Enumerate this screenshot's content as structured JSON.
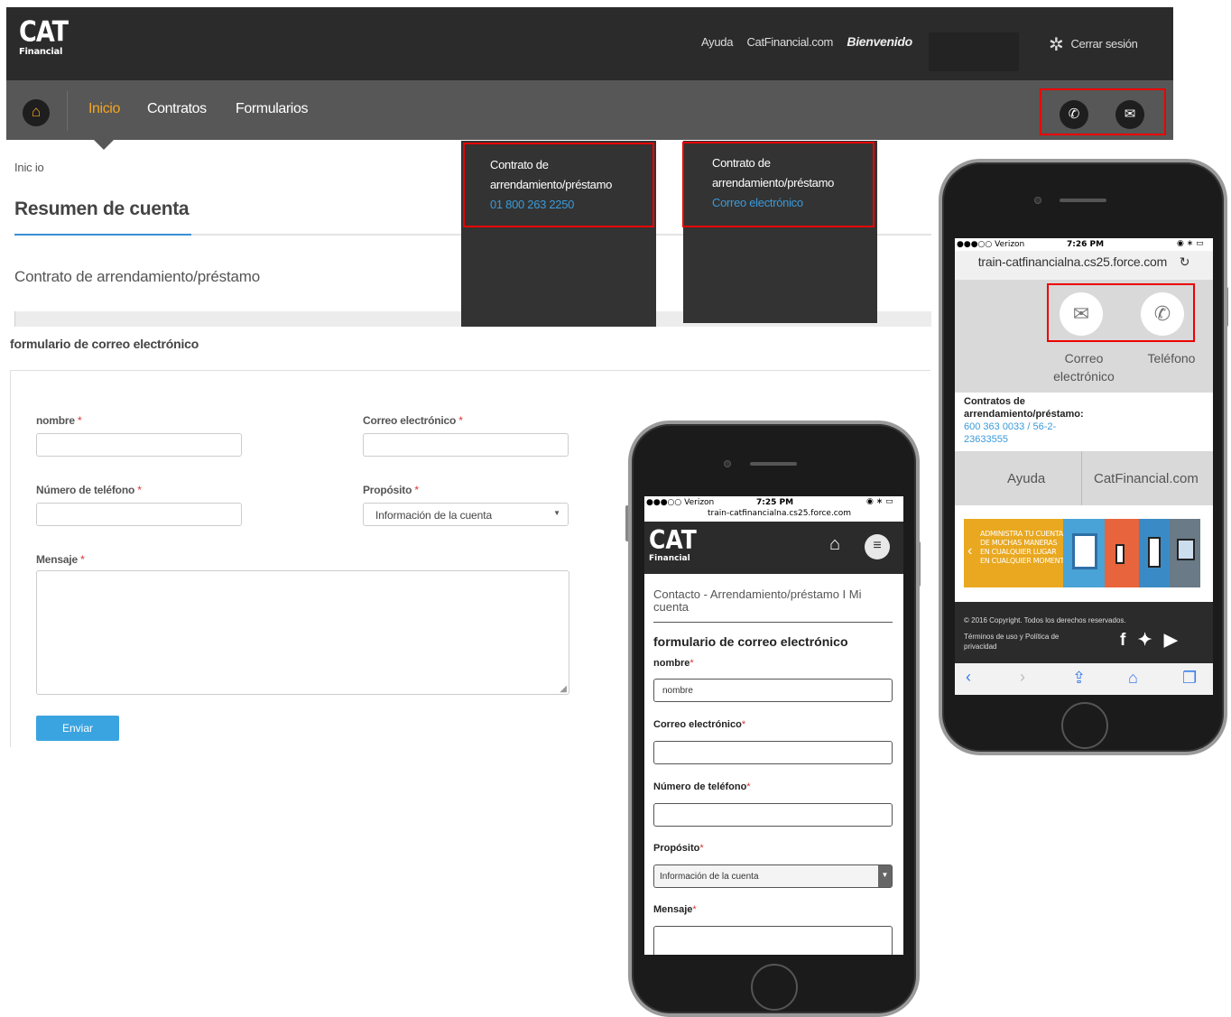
{
  "desktop": {
    "logo": {
      "brand": "CAT",
      "sub": "Financial"
    },
    "top_links": {
      "help": "Ayuda",
      "site": "CatFinancial.com",
      "welcome": "Bienvenido",
      "logout": "Cerrar sesión"
    },
    "nav": {
      "home_icon": "home-icon",
      "items": [
        "Inicio",
        "Contratos",
        "Formularios"
      ],
      "active": "Inicio"
    },
    "contact_icons": [
      "phone-icon",
      "mail-icon"
    ],
    "breadcrumb": "Inic io",
    "title": "Resumen de cuenta",
    "section_title": "Contrato de arrendamiento/préstamo",
    "dropdowns": [
      {
        "line1": "Contrato de",
        "line2": "arrendamiento/préstamo",
        "value": "01 800 263 2250"
      },
      {
        "line1": "Contrato de",
        "line2": "arrendamiento/préstamo",
        "value": "Correo electrónico"
      }
    ],
    "form": {
      "title": "formulario de correo electrónico",
      "name_label": "nombre",
      "email_label": "Correo electrónico",
      "phone_label": "Número de teléfono",
      "purpose_label": "Propósito",
      "purpose_value": "Información de la cuenta",
      "message_label": "Mensaje",
      "submit": "Enviar",
      "required_mark": "*"
    }
  },
  "phone_left": {
    "status": {
      "carrier": "●●●○○ Verizon",
      "time": "7:25 PM",
      "url": "train-catfinancialna.cs25.force.com"
    },
    "logo": {
      "brand": "CAT",
      "sub": "Financial"
    },
    "page_title": "Contacto - Arrendamiento/préstamo I Mi cuenta",
    "form_title": "formulario de correo electrónico",
    "name_label": "nombre",
    "name_placeholder": "nombre",
    "email_label": "Correo electrónico",
    "phone_label": "Número de teléfono",
    "purpose_label": "Propósito",
    "purpose_value": "Información de la cuenta",
    "message_label": "Mensaje",
    "required_mark": "*"
  },
  "phone_right": {
    "status": {
      "carrier": "●●●○○ Verizon",
      "time": "7:26 PM"
    },
    "url": "train-catfinancialna.cs25.force.com",
    "email_label": "Correo electrónico",
    "phone_label": "Teléfono",
    "contract_label": "Contratos de arrendamiento/préstamo:",
    "contract_phone": "600 363 0033 / 56-2-23633555",
    "help": "Ayuda",
    "site": "CatFinancial.com",
    "banner": [
      "ADMINISTRA TU CUENTA",
      "DE MUCHAS MANERAS",
      "EN CUALQUIER LUGAR",
      "EN CUALQUIER MOMENTO"
    ],
    "copyright": "© 2016 Copyright. Todos los derechos reservados.",
    "terms": "Términos de uso y Política de privacidad"
  },
  "colors": {
    "accent": "#f5a623",
    "link": "#3a9ad9",
    "button": "#3aa4e0",
    "highlight": "#e00000",
    "header": "#2b2b2b",
    "nav": "#575757"
  }
}
